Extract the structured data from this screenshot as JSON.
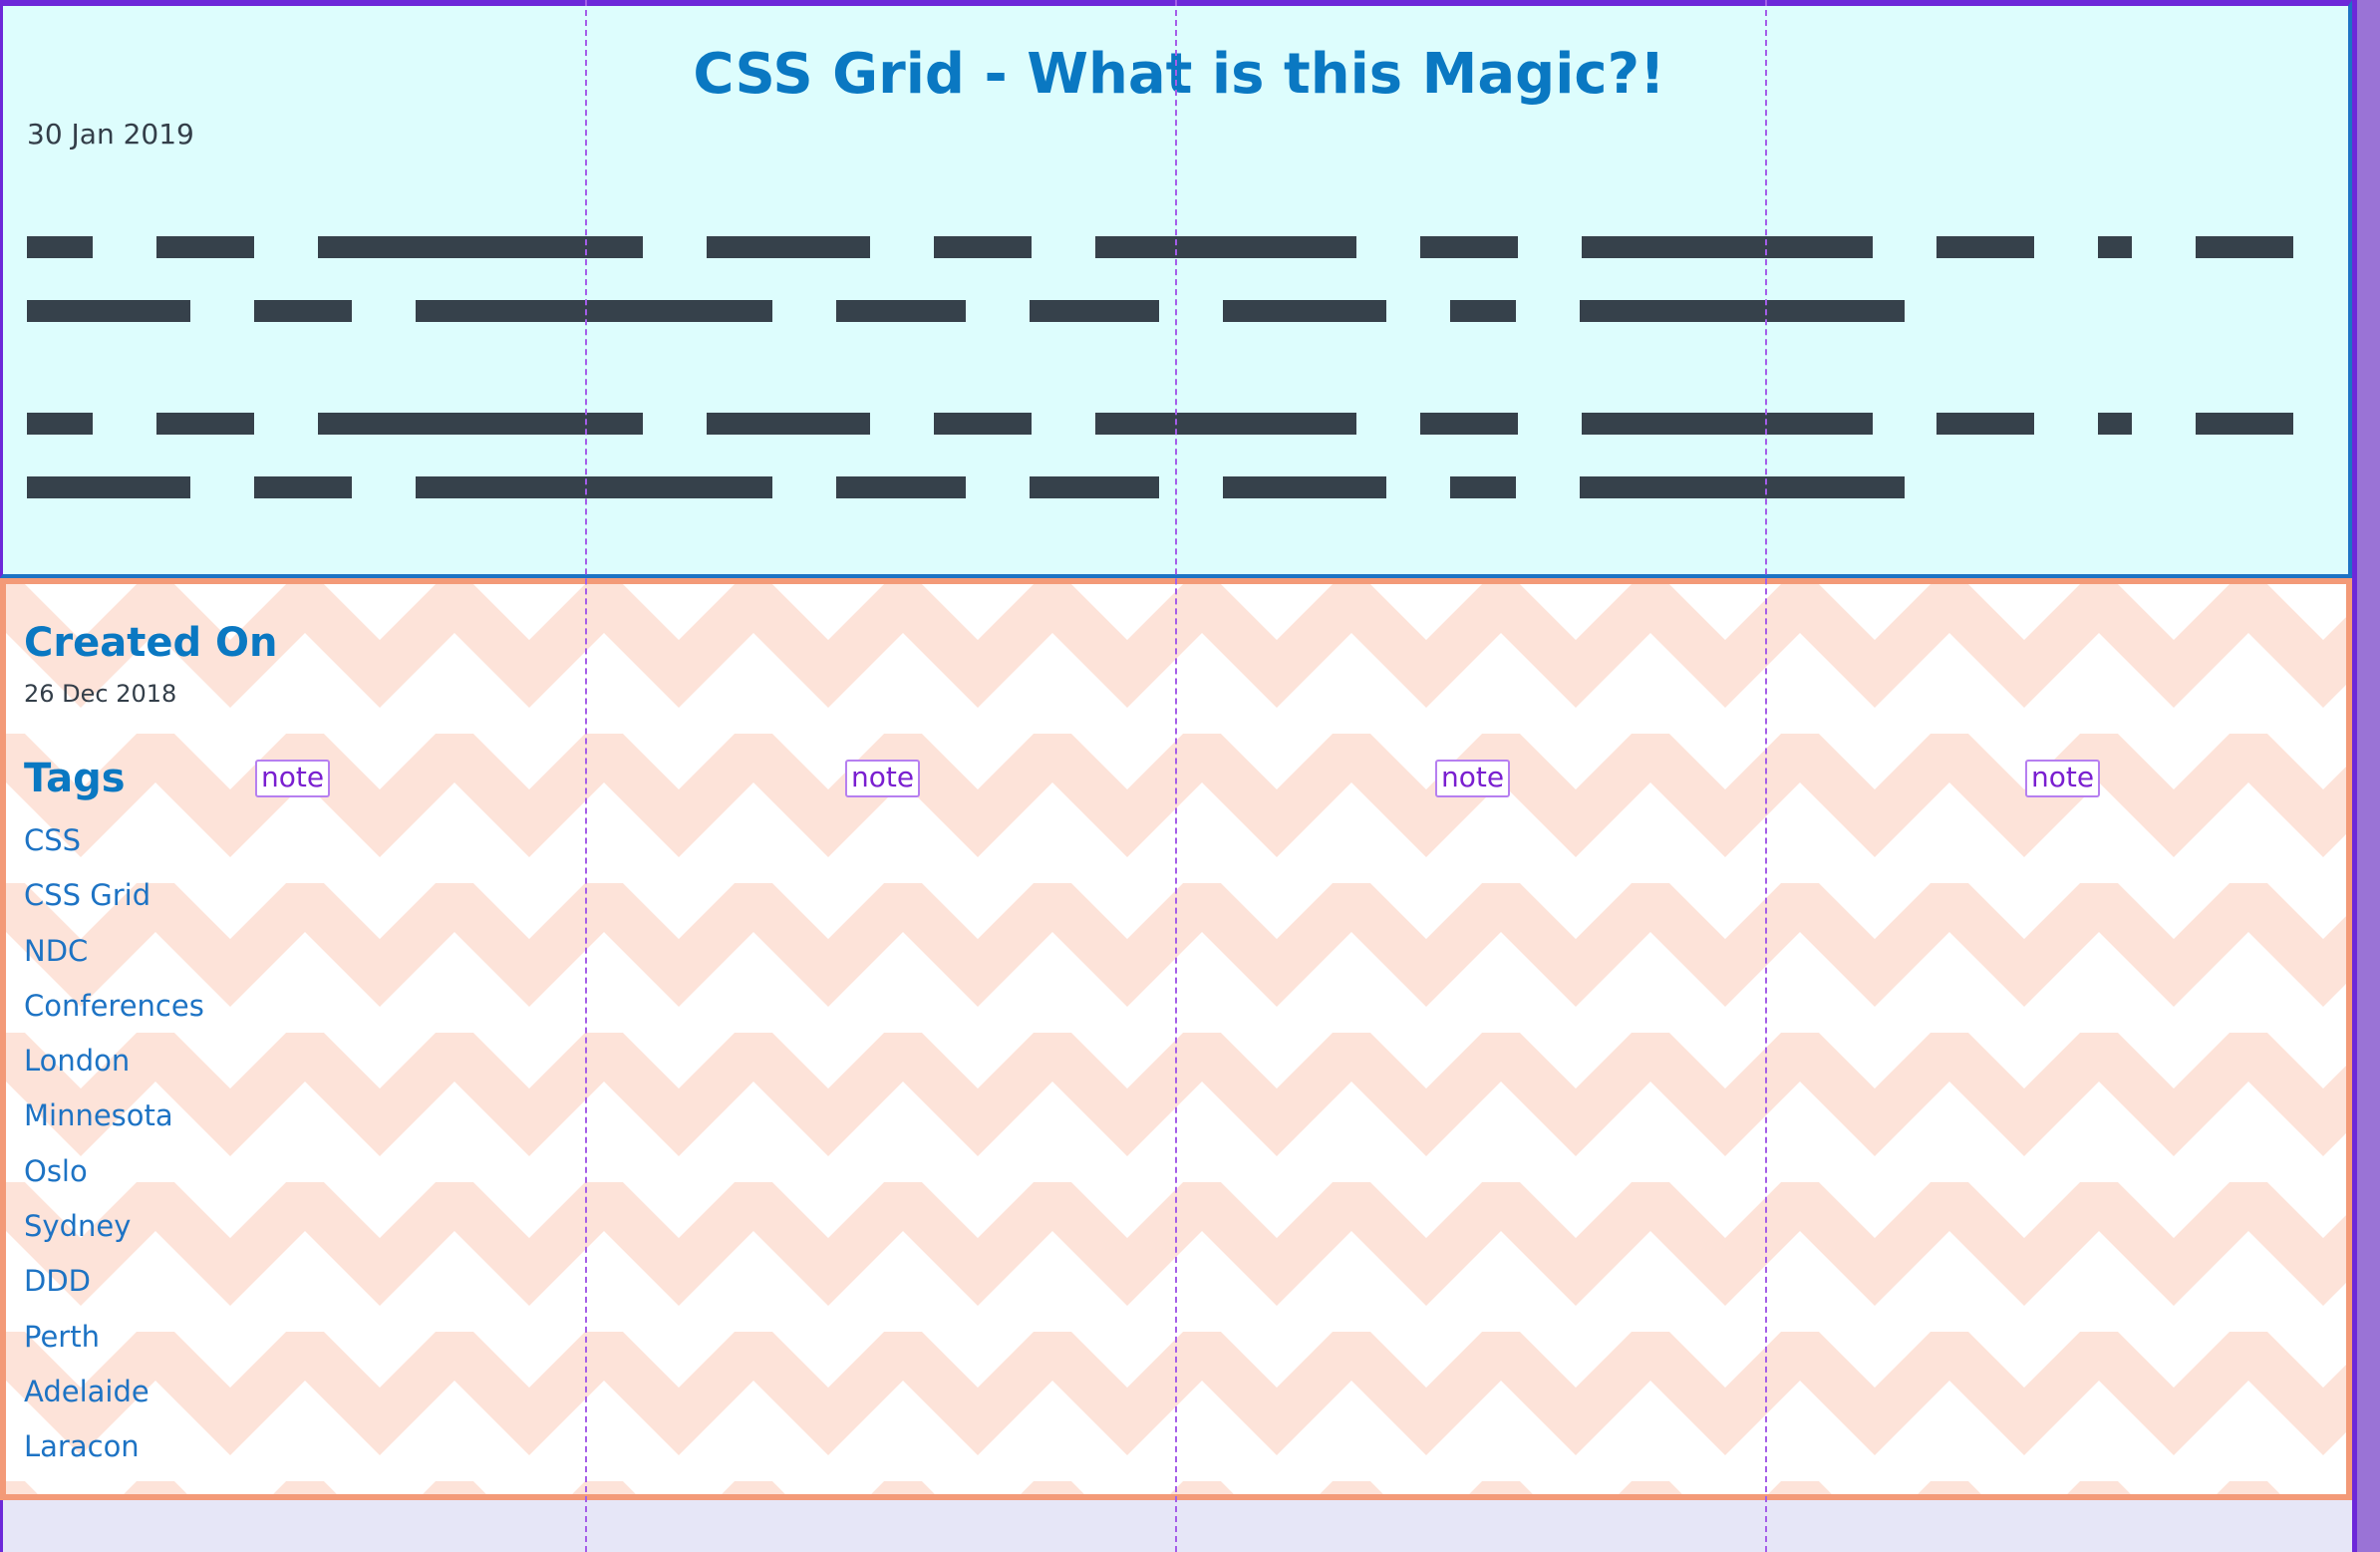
{
  "article": {
    "title": "CSS Grid - What is this Magic?!",
    "date": "30 Jan 2019"
  },
  "meta": {
    "created_heading": "Created On",
    "created_date": "26 Dec 2018",
    "tags_heading": "Tags",
    "tags": [
      "CSS",
      "CSS Grid",
      "NDC",
      "Conferences",
      "London",
      "Minnesota",
      "Oslo",
      "Sydney",
      "DDD",
      "Perth",
      "Adelaide",
      "Laracon"
    ]
  },
  "grid_overlay": {
    "note_label": "note",
    "note_count": 4
  },
  "colors": {
    "accent": "#0a78c2",
    "frame": "#6d28d9",
    "header_bg": "#ddfdfd",
    "meta_border": "#f39a78",
    "chevron": "#fde3d9",
    "redaction": "#36414b",
    "note": "#7a1fd0"
  }
}
